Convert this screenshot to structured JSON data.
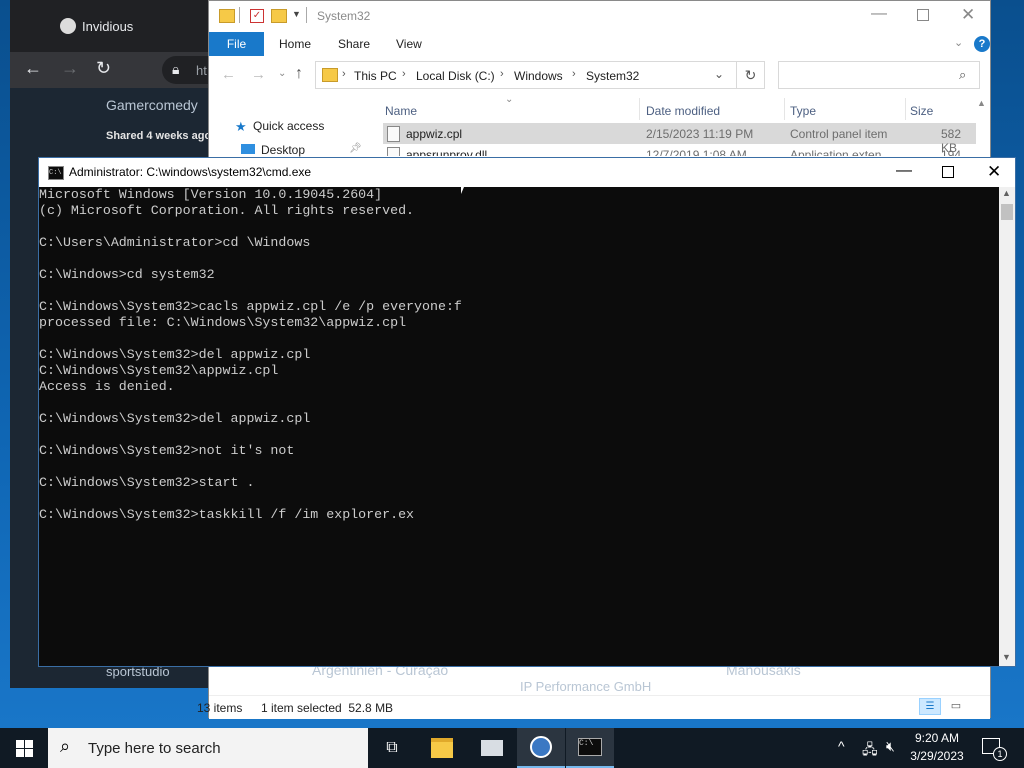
{
  "browser": {
    "tab_title": "Invidious",
    "address_partial": "ht",
    "channel_name": "Gamercomedy",
    "shared_text": "Shared 4 weeks ago",
    "bottom_left_text": "sportstudio"
  },
  "explorer": {
    "title": "System32",
    "ribbon_tabs": [
      "File",
      "Home",
      "Share",
      "View"
    ],
    "breadcrumb": [
      "This PC",
      "Local Disk (C:)",
      "Windows",
      "System32"
    ],
    "nav": {
      "quick_access": "Quick access",
      "desktop": "Desktop"
    },
    "columns": {
      "name": "Name",
      "date": "Date modified",
      "type": "Type",
      "size": "Size"
    },
    "rows": [
      {
        "name": "appwiz.cpl",
        "date": "2/15/2023 11:19 PM",
        "type": "Control panel item",
        "size": "582 KB"
      },
      {
        "name": "appsrunprov.dll",
        "date": "12/7/2019 1:08 AM",
        "type": "Application exten...",
        "size": "194 KB"
      }
    ],
    "status_items": "13 items",
    "status_selected": "1 item selected  52.8 MB",
    "bg_texts": [
      "Argentinien - Curaçao",
      "Manousakis",
      "IP Performance GmbH"
    ]
  },
  "cmd": {
    "title": "Administrator: C:\\windows\\system32\\cmd.exe",
    "output": "Microsoft Windows [Version 10.0.19045.2604]\n(c) Microsoft Corporation. All rights reserved.\n\nC:\\Users\\Administrator>cd \\Windows\n\nC:\\Windows>cd system32\n\nC:\\Windows\\System32>cacls appwiz.cpl /e /p everyone:f\nprocessed file: C:\\Windows\\System32\\appwiz.cpl\n\nC:\\Windows\\System32>del appwiz.cpl\nC:\\Windows\\System32\\appwiz.cpl\nAccess is denied.\n\nC:\\Windows\\System32>del appwiz.cpl\n\nC:\\Windows\\System32>not it's not\n\nC:\\Windows\\System32>start .\n\nC:\\Windows\\System32>taskkill /f /im explorer.ex"
  },
  "taskbar": {
    "search_placeholder": "Type here to search",
    "time": "9:20 AM",
    "date": "3/29/2023",
    "notification_count": "1"
  }
}
